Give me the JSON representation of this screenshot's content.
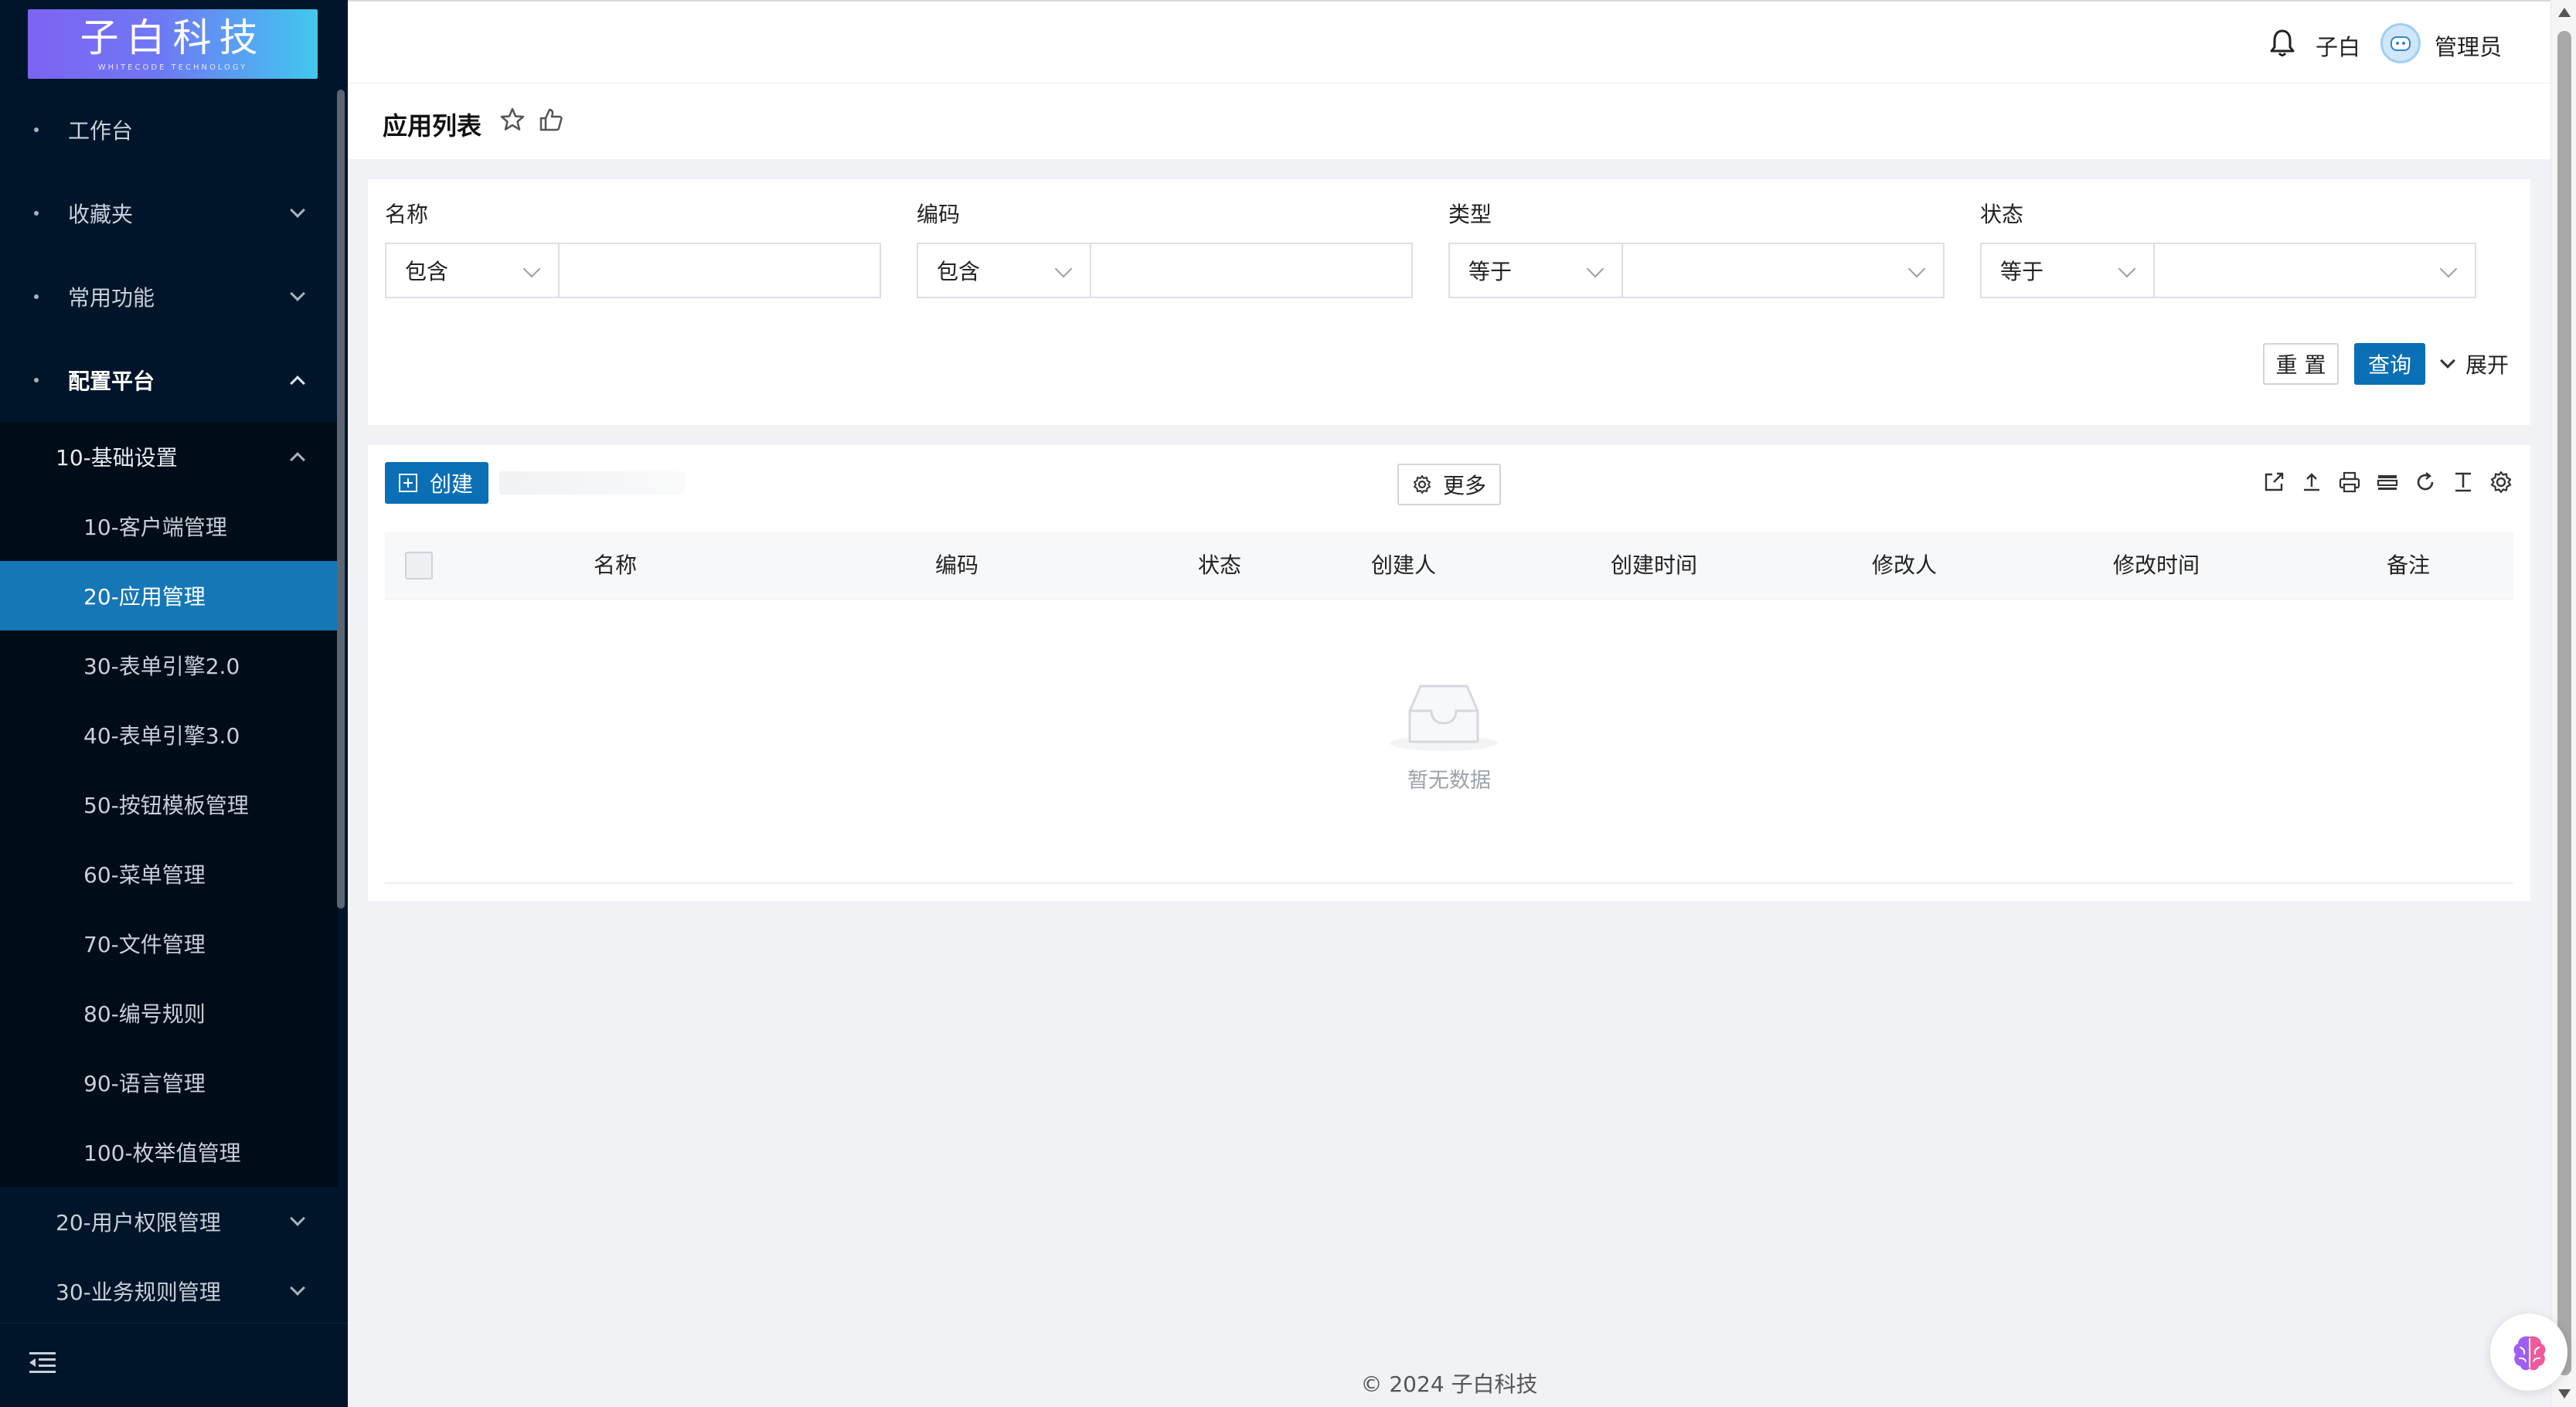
{
  "brand": {
    "logo_text": "子白科技",
    "logo_sub": "WHITECODE TECHNOLOGY",
    "colors": {
      "sidebar": "#001529",
      "primary": "#0a6fb5",
      "active_item": "#1677b6"
    }
  },
  "sidebar": {
    "items": [
      {
        "label": "工作台",
        "icon": "dot"
      },
      {
        "label": "收藏夹",
        "icon": "dot"
      },
      {
        "label": "常用功能",
        "icon": "dot"
      },
      {
        "label": "配置平台",
        "icon": "dot"
      }
    ],
    "config_group": {
      "label": "10-基础设置",
      "items": [
        "10-客户端管理",
        "20-应用管理",
        "30-表单引擎2.0",
        "40-表单引擎3.0",
        "50-按钮模板管理",
        "60-菜单管理",
        "70-文件管理",
        "80-编号规则",
        "90-语言管理",
        "100-枚举值管理"
      ],
      "active_index": 1
    },
    "other_groups": [
      "20-用户权限管理",
      "30-业务规则管理"
    ],
    "collapse_icon": "menu-fold-icon"
  },
  "header": {
    "user": "子白",
    "role": "管理员",
    "icons": [
      "bell-icon",
      "avatar"
    ]
  },
  "page": {
    "title": "应用列表",
    "icons": [
      "star-icon",
      "thumb-up-icon"
    ]
  },
  "filter": {
    "fields": [
      {
        "label": "名称",
        "operator": "包含",
        "value": ""
      },
      {
        "label": "编码",
        "operator": "包含",
        "value": ""
      },
      {
        "label": "类型",
        "operator": "等于",
        "value": ""
      },
      {
        "label": "状态",
        "operator": "等于",
        "value": ""
      }
    ],
    "reset_label": "重 置",
    "query_label": "查询",
    "expand_label": "展开"
  },
  "table": {
    "create_label": "创建",
    "more_label": "更多",
    "toolbar_icons": [
      "export-icon",
      "upload-icon",
      "print-icon",
      "columns-icon",
      "refresh-icon",
      "text-height-icon",
      "settings-icon"
    ],
    "columns": [
      "名称",
      "编码",
      "状态",
      "创建人",
      "创建时间",
      "修改人",
      "修改时间",
      "备注"
    ],
    "rows": [],
    "empty_text": "暂无数据"
  },
  "footer": {
    "text": "© 2024 子白科技"
  }
}
